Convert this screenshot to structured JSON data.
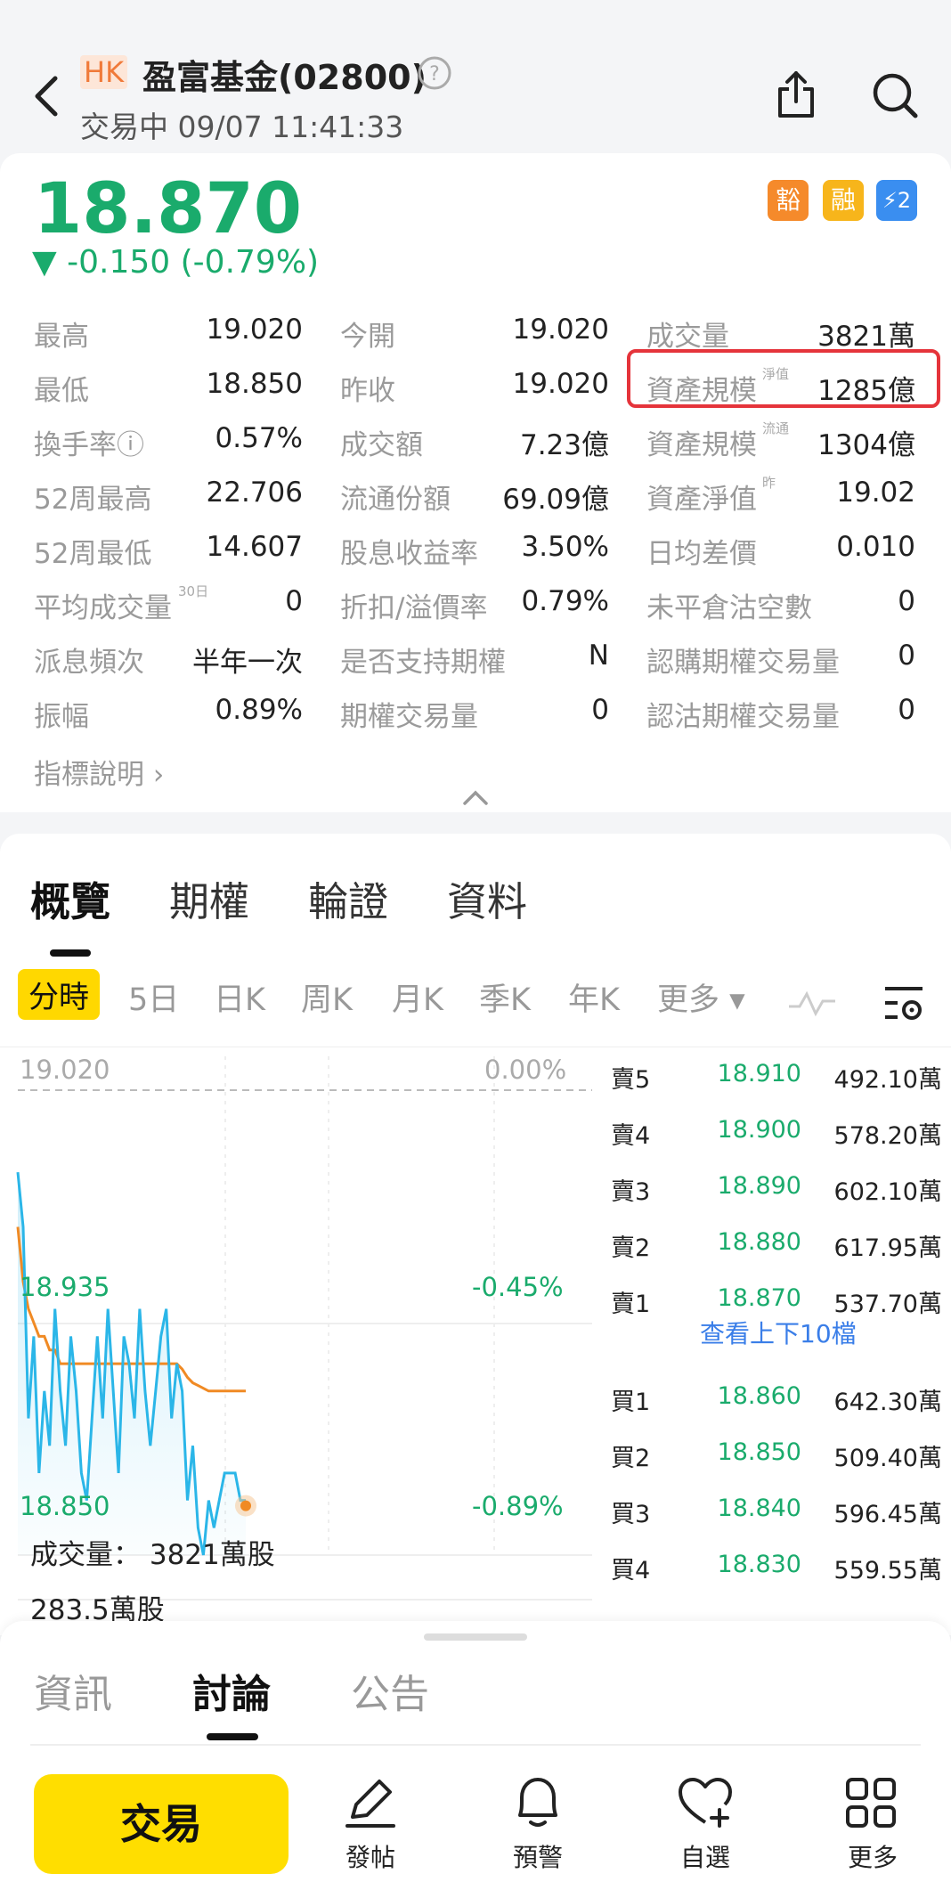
{
  "header": {
    "market": "HK",
    "title": "盈富基金(02800)",
    "status": "交易中 09/07 11:41:33",
    "help_icon": "question-circle-icon",
    "back_icon": "chevron-left-icon",
    "share_icon": "share-icon",
    "search_icon": "search-icon"
  },
  "quote": {
    "price": "18.870",
    "change": "▼ -0.150 (-0.79%)",
    "badges": [
      "豁",
      "融",
      "⚡2"
    ],
    "down_color": "#1aab6c"
  },
  "stats": {
    "c1": [
      {
        "label": "最高",
        "value": "19.020"
      },
      {
        "label": "最低",
        "value": "18.850"
      },
      {
        "label": "換手率ⓘ",
        "value": "0.57%"
      },
      {
        "label": "52周最高",
        "value": "22.706"
      },
      {
        "label": "52周最低",
        "value": "14.607"
      },
      {
        "label": "平均成交量",
        "sup": "30日",
        "value": "0"
      },
      {
        "label": "派息頻次",
        "value": "半年一次"
      },
      {
        "label": "振幅",
        "value": "0.89%"
      }
    ],
    "c2": [
      {
        "label": "今開",
        "value": "19.020"
      },
      {
        "label": "昨收",
        "value": "19.020"
      },
      {
        "label": "成交額",
        "value": "7.23億"
      },
      {
        "label": "流通份額",
        "value": "69.09億"
      },
      {
        "label": "股息收益率",
        "value": "3.50%"
      },
      {
        "label": "折扣/溢價率",
        "value": "0.79%"
      },
      {
        "label": "是否支持期權",
        "value": "N"
      },
      {
        "label": "期權交易量",
        "value": "0"
      }
    ],
    "c3": [
      {
        "label": "成交量",
        "value": "3821萬"
      },
      {
        "label": "資產規模",
        "sup": "淨值",
        "value": "1285億"
      },
      {
        "label": "資產規模",
        "sup": "流通",
        "value": "1304億"
      },
      {
        "label": "資產淨值",
        "sup": "昨",
        "value": "19.02"
      },
      {
        "label": "日均差價",
        "value": "0.010"
      },
      {
        "label": "未平倉沽空數",
        "value": "0"
      },
      {
        "label": "認購期權交易量",
        "value": "0"
      },
      {
        "label": "認沽期權交易量",
        "value": "0"
      }
    ],
    "indicator_link": "指標說明 ›",
    "highlight_color": "#e5343b"
  },
  "tabs": [
    "概覽",
    "期權",
    "輪證",
    "資料"
  ],
  "period_tabs": [
    "分時",
    "5日",
    "日K",
    "周K",
    "月K",
    "季K",
    "年K",
    "更多 ▾"
  ],
  "chart": {
    "prev_close": "19.020",
    "pct_top": "0.00%",
    "mid_price": "18.935",
    "pct_mid": "-0.45%",
    "low_price": "18.850",
    "pct_low": "-0.89%",
    "volume_label": "成交量： 3821萬股",
    "bar_volume": "283.5萬股",
    "price_series": [
      18.99,
      18.97,
      18.9,
      18.93,
      18.88,
      18.91,
      18.89,
      18.94,
      18.91,
      18.89,
      18.93,
      18.91,
      18.88,
      18.87,
      18.9,
      18.93,
      18.9,
      18.94,
      18.91,
      18.88,
      18.93,
      18.92,
      18.9,
      18.94,
      18.91,
      18.89,
      18.91,
      18.93,
      18.94,
      18.9,
      18.92,
      18.91,
      18.87,
      18.89,
      18.86,
      18.85,
      18.87,
      18.86,
      18.87,
      18.88,
      18.88,
      18.88,
      18.87,
      18.87
    ],
    "avg_series": [
      18.97,
      18.95,
      18.94,
      18.935,
      18.93,
      18.93,
      18.925,
      18.925,
      18.92,
      18.92,
      18.92,
      18.92,
      18.92,
      18.92,
      18.92,
      18.92,
      18.92,
      18.92,
      18.92,
      18.92,
      18.92,
      18.92,
      18.92,
      18.92,
      18.92,
      18.92,
      18.92,
      18.92,
      18.92,
      18.92,
      18.92,
      18.918,
      18.915,
      18.913,
      18.912,
      18.911,
      18.91,
      18.91,
      18.91,
      18.91,
      18.91,
      18.91,
      18.91,
      18.91
    ],
    "ylim": [
      18.85,
      19.02
    ],
    "line_color": "#2bb6e8",
    "avg_color": "#f08a24"
  },
  "orderbook": {
    "asks": [
      {
        "label": "賣5",
        "price": "18.910",
        "vol": "492.10萬"
      },
      {
        "label": "賣4",
        "price": "18.900",
        "vol": "578.20萬"
      },
      {
        "label": "賣3",
        "price": "18.890",
        "vol": "602.10萬"
      },
      {
        "label": "賣2",
        "price": "18.880",
        "vol": "617.95萬"
      },
      {
        "label": "賣1",
        "price": "18.870",
        "vol": "537.70萬"
      }
    ],
    "more_link": "查看上下10檔",
    "bids": [
      {
        "label": "買1",
        "price": "18.860",
        "vol": "642.30萬"
      },
      {
        "label": "買2",
        "price": "18.850",
        "vol": "509.40萬"
      },
      {
        "label": "買3",
        "price": "18.840",
        "vol": "596.45萬"
      },
      {
        "label": "買4",
        "price": "18.830",
        "vol": "559.55萬"
      }
    ]
  },
  "content_tabs": [
    "資訊",
    "討論",
    "公告"
  ],
  "bottom_bar": {
    "trade": "交易",
    "items": [
      {
        "icon": "pen-icon",
        "label": "發帖"
      },
      {
        "icon": "bell-icon",
        "label": "預警"
      },
      {
        "icon": "heart-plus-icon",
        "label": "自選"
      },
      {
        "icon": "grid-icon",
        "label": "更多"
      }
    ]
  }
}
